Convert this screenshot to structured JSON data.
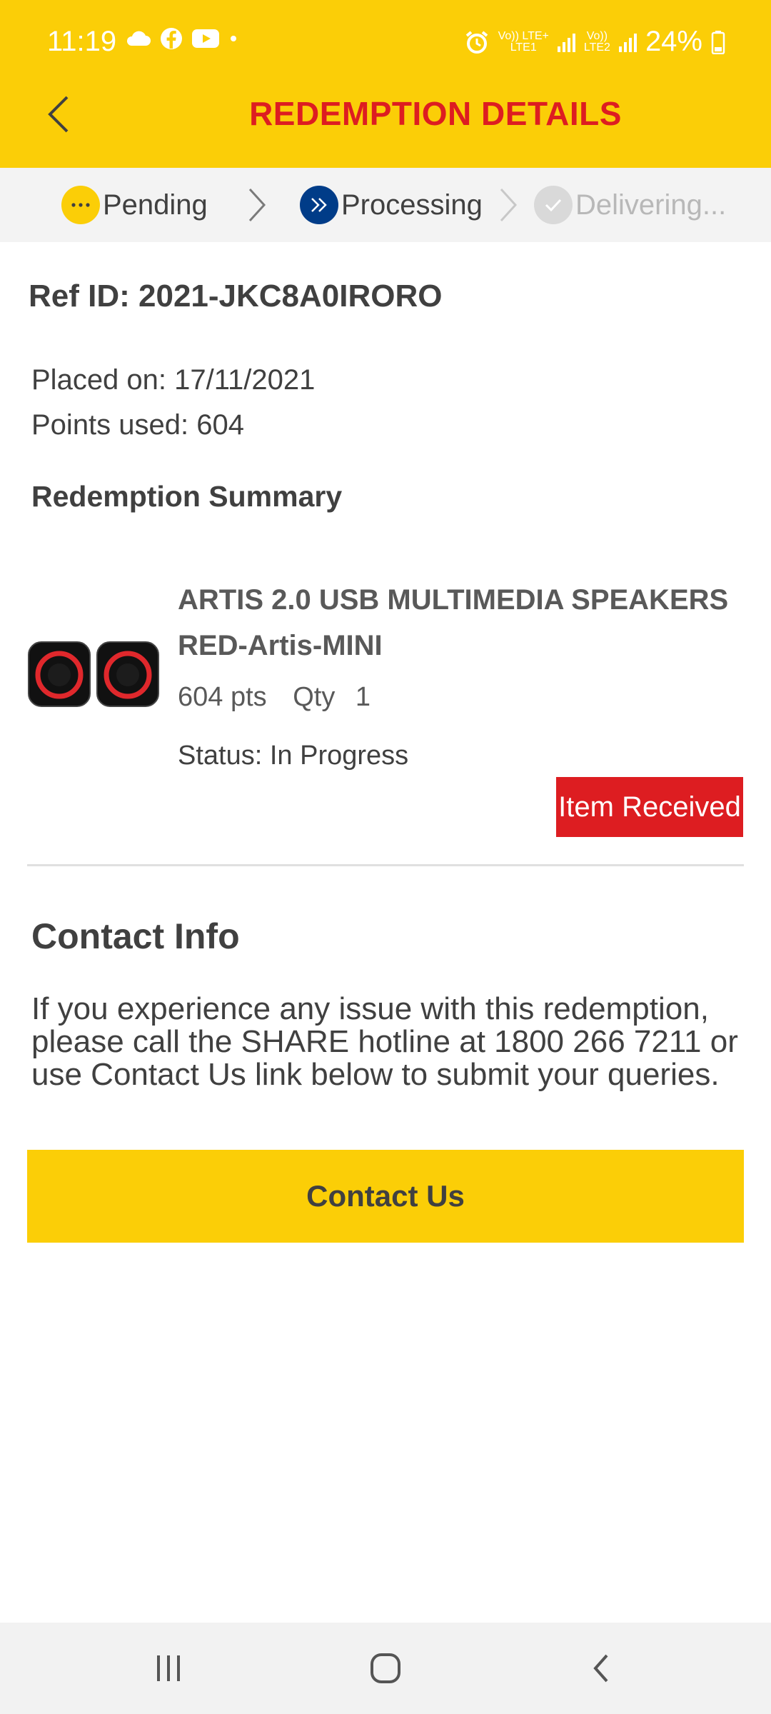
{
  "status_bar": {
    "time": "11:19",
    "net1_top": "Vo)) LTE+",
    "net1_bottom": "LTE1",
    "net2_top": "Vo))",
    "net2_bottom": "LTE2",
    "battery": "24%",
    "icons": [
      "cloud-icon",
      "facebook-icon",
      "youtube-icon",
      "dot-icon",
      "alarm-icon",
      "signal-icon",
      "battery-icon"
    ]
  },
  "header": {
    "title": "REDEMPTION DETAILS",
    "back_icon": "chevron-left-icon"
  },
  "stepper": {
    "steps": [
      {
        "label": "Pending",
        "state": "done",
        "color": "#FBCE07"
      },
      {
        "label": "Processing",
        "state": "current",
        "color": "#003C88"
      },
      {
        "label": "Delivering...",
        "state": "upcoming",
        "color": "#d9d9d9"
      }
    ]
  },
  "order": {
    "ref_id": "Ref ID: 2021-JKC8A0IRORO",
    "placed_on": "Placed on: 17/11/2021",
    "points_used": "Points used: 604"
  },
  "summary": {
    "title": "Redemption Summary",
    "item": {
      "name": "ARTIS 2.0 USB MULTIMEDIA SPEAKERS RED-Artis-MINI",
      "points": "604 pts",
      "qty_label": "Qty",
      "qty": "1",
      "status": "Status: In Progress",
      "action_label": "Item Received"
    }
  },
  "contact": {
    "title": "Contact Info",
    "text": "If you experience any issue with this redemption, please call the SHARE hotline at 1800 266 7211 or use Contact Us link below to submit your queries.",
    "button_label": "Contact Us"
  },
  "colors": {
    "brand_yellow": "#FBCE07",
    "brand_red": "#DD1D21",
    "brand_blue": "#003C88"
  }
}
